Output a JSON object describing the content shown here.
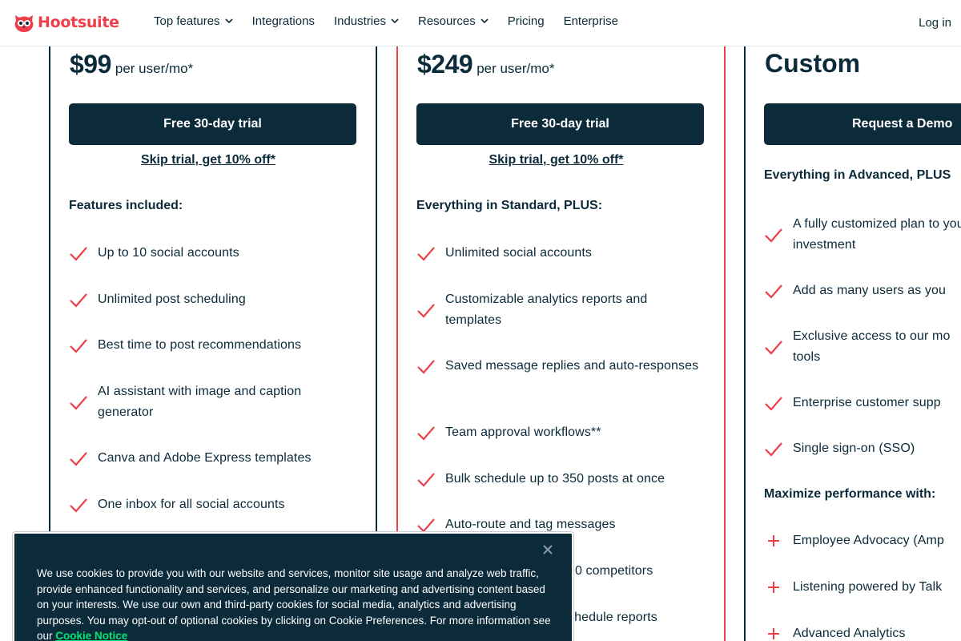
{
  "brand": {
    "name": "Hootsuite",
    "color": "#ef3e4a",
    "navy": "#0b2a3a"
  },
  "nav": {
    "items": [
      {
        "label": "Top features",
        "has_dropdown": true
      },
      {
        "label": "Integrations",
        "has_dropdown": false
      },
      {
        "label": "Industries",
        "has_dropdown": true
      },
      {
        "label": "Resources",
        "has_dropdown": true
      },
      {
        "label": "Pricing",
        "has_dropdown": false
      },
      {
        "label": "Enterprise",
        "has_dropdown": false
      }
    ],
    "login": "Log in"
  },
  "plans": {
    "standard": {
      "price": "$99",
      "unit": "per user/mo*",
      "cta": "Free 30-day trial",
      "skip": "Skip trial, get 10% off*",
      "section_title": "Features included:",
      "features": [
        "Up to 10 social accounts",
        "Unlimited post scheduling",
        "Best time to post recommendations",
        "AI assistant with image and caption generator",
        "Canva and Adobe Express templates",
        "One inbox for all social accounts"
      ]
    },
    "advanced": {
      "price": "$249",
      "unit": "per user/mo*",
      "cta": "Free 30-day trial",
      "skip": "Skip trial, get 10% off*",
      "section_title": "Everything in Standard, PLUS:",
      "features": [
        "Unlimited social accounts",
        "Customizable analytics reports and templates",
        "Saved message replies and auto-responses",
        "Team approval workflows**",
        "Bulk schedule up to 350 posts at once",
        "Auto-route and tag messages",
        "20 competitors",
        "chedule reports"
      ]
    },
    "enterprise": {
      "price": "Custom",
      "cta": "Request a Demo",
      "section_title": "Everything in Advanced, PLUS",
      "features": [
        "A fully customized plan to your investment",
        "Add as many users as you",
        "Exclusive access to our mo tools",
        "Enterprise customer supp",
        "Single sign-on (SSO)"
      ],
      "addons_title": "Maximize performance with:",
      "addons": [
        "Employee Advocacy (Amp",
        "Listening powered by Talk",
        "Advanced Analytics"
      ]
    }
  },
  "cookie": {
    "text": "We use cookies to provide you with our website and services, monitor site usage and analyze web traffic, provide enhanced functionality and services, and personalize our marketing and advertising content based on your interests. We use our own and third-party cookies for social media, analytics and advertising purposes. You may opt-out of optional cookies by clicking on Cookie Preferences. For more information see our ",
    "link": "Cookie Notice"
  },
  "icons": {
    "check": "check-icon",
    "plus": "plus-icon",
    "close": "close-icon",
    "chevron": "chevron-down-icon",
    "logo": "hootsuite-owl-icon"
  }
}
